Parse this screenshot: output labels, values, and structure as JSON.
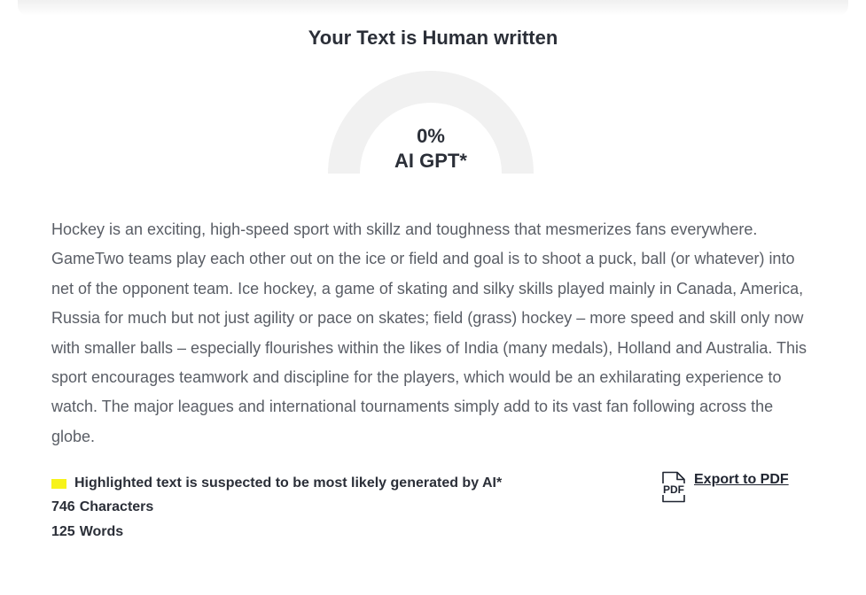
{
  "result": {
    "title": "Your Text is Human written",
    "gauge": {
      "value_label": "0%",
      "caption": "AI GPT*",
      "ai_fraction": 0,
      "track_color": "#f1f1f1",
      "fill_color": "#f7f31a"
    }
  },
  "analyzed_text": "Hockey is an exciting, high-speed sport with skillz and toughness that mesmerizes fans everywhere. GameTwo teams play each other out on the ice or field and goal is to shoot a puck, ball (or whatever) into net of the opponent team. Ice hockey, a game of skating and silky skills played mainly in Canada, America, Russia for much but not just agility or pace on skates; field (grass) hockey – more speed and skill only now with smaller balls – especially flourishes within the likes of India (many medals), Holland and Australia. This sport encourages teamwork and discipline for the players, which would be an exhilarating experience to watch. The major leagues and international tournaments simply add to its vast fan following across the globe.",
  "legend": {
    "text": "Highlighted text is suspected to be most likely generated by AI*",
    "highlight_color": "#f7f31a"
  },
  "stats": {
    "characters_count": "746",
    "characters_label": "Characters",
    "words_count": "125",
    "words_label": "Words"
  },
  "export": {
    "label": "Export to PDF",
    "icon": "pdf-file-icon",
    "icon_text": "PDF"
  }
}
